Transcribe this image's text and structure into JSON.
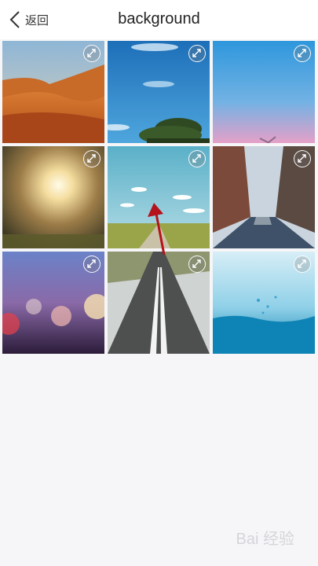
{
  "header": {
    "back_label": "返回",
    "title": "background"
  },
  "tiles": [
    {
      "name": "desert"
    },
    {
      "name": "sky-tree"
    },
    {
      "name": "pink-sky"
    },
    {
      "name": "sunlight"
    },
    {
      "name": "road-field"
    },
    {
      "name": "city-street"
    },
    {
      "name": "bokeh"
    },
    {
      "name": "highway"
    },
    {
      "name": "water-splash"
    }
  ],
  "watermark": "Bai 经验",
  "colors": {
    "accent_arrow": "#b5121b",
    "background": "#f6f6f8"
  }
}
